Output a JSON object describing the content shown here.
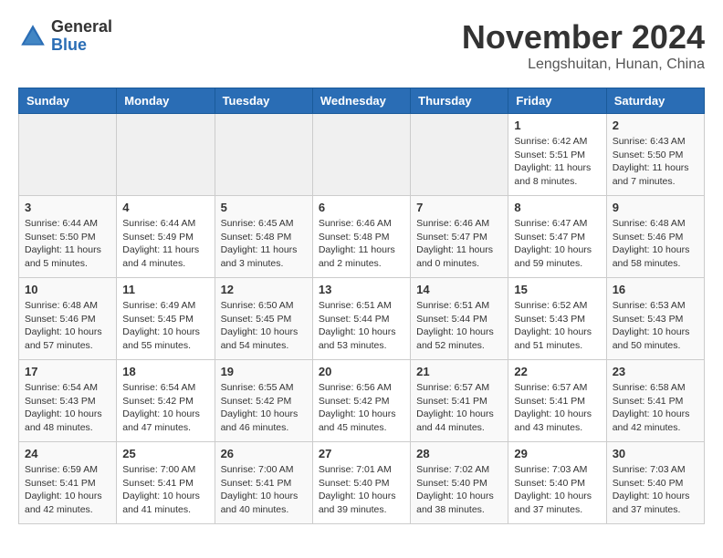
{
  "logo": {
    "general": "General",
    "blue": "Blue"
  },
  "title": "November 2024",
  "location": "Lengshuitan, Hunan, China",
  "headers": [
    "Sunday",
    "Monday",
    "Tuesday",
    "Wednesday",
    "Thursday",
    "Friday",
    "Saturday"
  ],
  "weeks": [
    [
      {
        "day": "",
        "info": ""
      },
      {
        "day": "",
        "info": ""
      },
      {
        "day": "",
        "info": ""
      },
      {
        "day": "",
        "info": ""
      },
      {
        "day": "",
        "info": ""
      },
      {
        "day": "1",
        "info": "Sunrise: 6:42 AM\nSunset: 5:51 PM\nDaylight: 11 hours and 8 minutes."
      },
      {
        "day": "2",
        "info": "Sunrise: 6:43 AM\nSunset: 5:50 PM\nDaylight: 11 hours and 7 minutes."
      }
    ],
    [
      {
        "day": "3",
        "info": "Sunrise: 6:44 AM\nSunset: 5:50 PM\nDaylight: 11 hours and 5 minutes."
      },
      {
        "day": "4",
        "info": "Sunrise: 6:44 AM\nSunset: 5:49 PM\nDaylight: 11 hours and 4 minutes."
      },
      {
        "day": "5",
        "info": "Sunrise: 6:45 AM\nSunset: 5:48 PM\nDaylight: 11 hours and 3 minutes."
      },
      {
        "day": "6",
        "info": "Sunrise: 6:46 AM\nSunset: 5:48 PM\nDaylight: 11 hours and 2 minutes."
      },
      {
        "day": "7",
        "info": "Sunrise: 6:46 AM\nSunset: 5:47 PM\nDaylight: 11 hours and 0 minutes."
      },
      {
        "day": "8",
        "info": "Sunrise: 6:47 AM\nSunset: 5:47 PM\nDaylight: 10 hours and 59 minutes."
      },
      {
        "day": "9",
        "info": "Sunrise: 6:48 AM\nSunset: 5:46 PM\nDaylight: 10 hours and 58 minutes."
      }
    ],
    [
      {
        "day": "10",
        "info": "Sunrise: 6:48 AM\nSunset: 5:46 PM\nDaylight: 10 hours and 57 minutes."
      },
      {
        "day": "11",
        "info": "Sunrise: 6:49 AM\nSunset: 5:45 PM\nDaylight: 10 hours and 55 minutes."
      },
      {
        "day": "12",
        "info": "Sunrise: 6:50 AM\nSunset: 5:45 PM\nDaylight: 10 hours and 54 minutes."
      },
      {
        "day": "13",
        "info": "Sunrise: 6:51 AM\nSunset: 5:44 PM\nDaylight: 10 hours and 53 minutes."
      },
      {
        "day": "14",
        "info": "Sunrise: 6:51 AM\nSunset: 5:44 PM\nDaylight: 10 hours and 52 minutes."
      },
      {
        "day": "15",
        "info": "Sunrise: 6:52 AM\nSunset: 5:43 PM\nDaylight: 10 hours and 51 minutes."
      },
      {
        "day": "16",
        "info": "Sunrise: 6:53 AM\nSunset: 5:43 PM\nDaylight: 10 hours and 50 minutes."
      }
    ],
    [
      {
        "day": "17",
        "info": "Sunrise: 6:54 AM\nSunset: 5:43 PM\nDaylight: 10 hours and 48 minutes."
      },
      {
        "day": "18",
        "info": "Sunrise: 6:54 AM\nSunset: 5:42 PM\nDaylight: 10 hours and 47 minutes."
      },
      {
        "day": "19",
        "info": "Sunrise: 6:55 AM\nSunset: 5:42 PM\nDaylight: 10 hours and 46 minutes."
      },
      {
        "day": "20",
        "info": "Sunrise: 6:56 AM\nSunset: 5:42 PM\nDaylight: 10 hours and 45 minutes."
      },
      {
        "day": "21",
        "info": "Sunrise: 6:57 AM\nSunset: 5:41 PM\nDaylight: 10 hours and 44 minutes."
      },
      {
        "day": "22",
        "info": "Sunrise: 6:57 AM\nSunset: 5:41 PM\nDaylight: 10 hours and 43 minutes."
      },
      {
        "day": "23",
        "info": "Sunrise: 6:58 AM\nSunset: 5:41 PM\nDaylight: 10 hours and 42 minutes."
      }
    ],
    [
      {
        "day": "24",
        "info": "Sunrise: 6:59 AM\nSunset: 5:41 PM\nDaylight: 10 hours and 42 minutes."
      },
      {
        "day": "25",
        "info": "Sunrise: 7:00 AM\nSunset: 5:41 PM\nDaylight: 10 hours and 41 minutes."
      },
      {
        "day": "26",
        "info": "Sunrise: 7:00 AM\nSunset: 5:41 PM\nDaylight: 10 hours and 40 minutes."
      },
      {
        "day": "27",
        "info": "Sunrise: 7:01 AM\nSunset: 5:40 PM\nDaylight: 10 hours and 39 minutes."
      },
      {
        "day": "28",
        "info": "Sunrise: 7:02 AM\nSunset: 5:40 PM\nDaylight: 10 hours and 38 minutes."
      },
      {
        "day": "29",
        "info": "Sunrise: 7:03 AM\nSunset: 5:40 PM\nDaylight: 10 hours and 37 minutes."
      },
      {
        "day": "30",
        "info": "Sunrise: 7:03 AM\nSunset: 5:40 PM\nDaylight: 10 hours and 37 minutes."
      }
    ]
  ]
}
